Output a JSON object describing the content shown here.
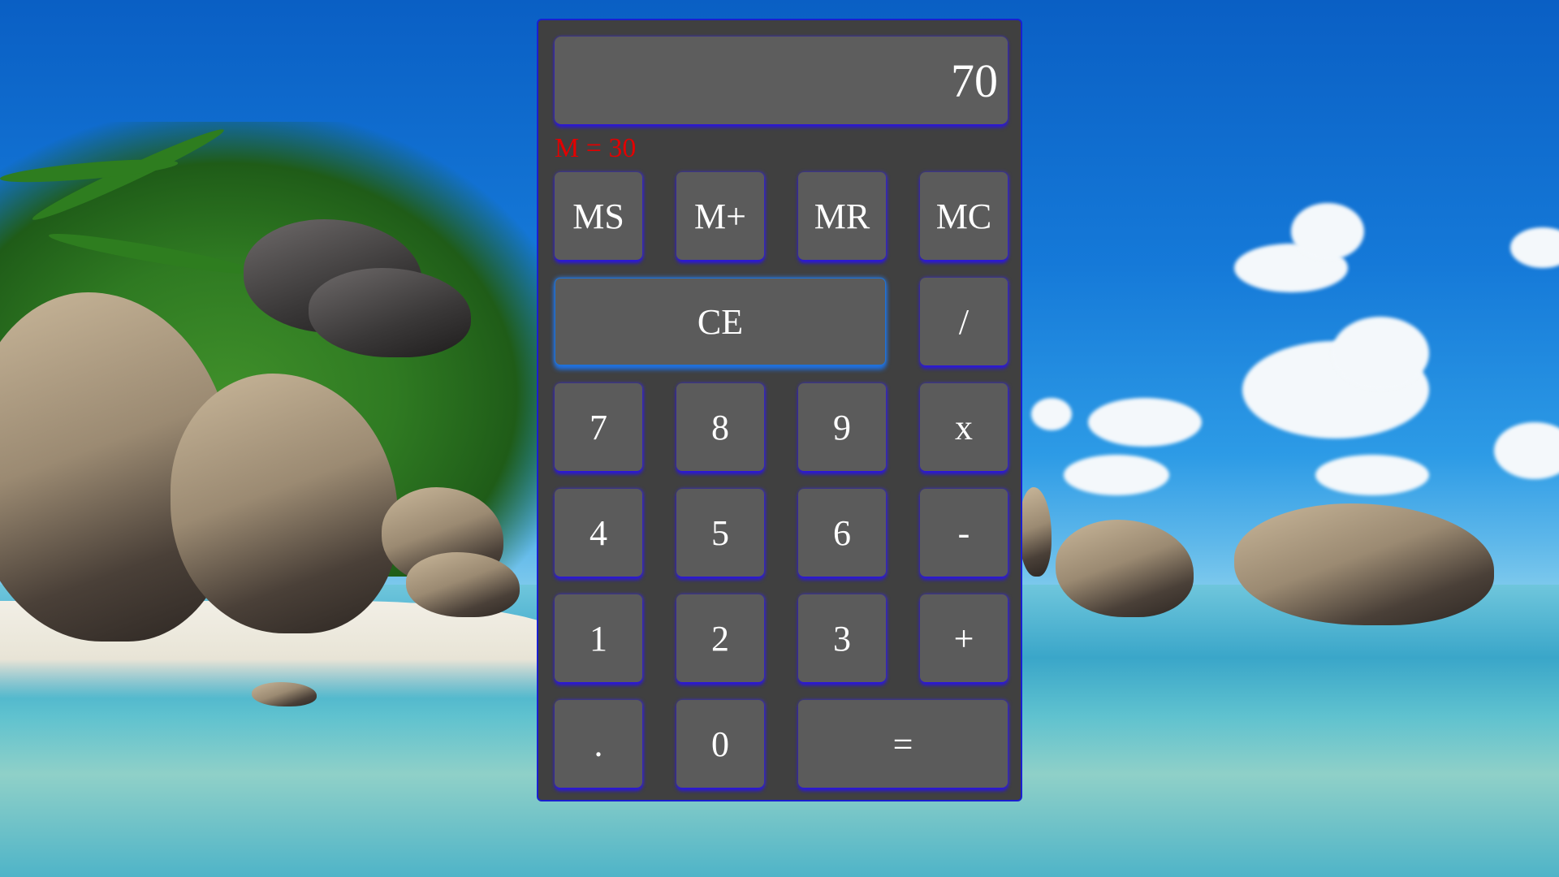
{
  "display": {
    "value": "70"
  },
  "memory": {
    "indicator": "M = 30"
  },
  "buttons": {
    "ms": "MS",
    "m_plus": "M+",
    "mr": "MR",
    "mc": "MC",
    "ce": "CE",
    "divide": "/",
    "multiply": "x",
    "subtract": "-",
    "add": "+",
    "equals": "=",
    "decimal": ".",
    "d0": "0",
    "d1": "1",
    "d2": "2",
    "d3": "3",
    "d4": "4",
    "d5": "5",
    "d6": "6",
    "d7": "7",
    "d8": "8",
    "d9": "9"
  },
  "colors": {
    "calculator_body": "#404040",
    "button_face": "#5b5b5b",
    "button_glow": "#2b17d8",
    "memory_text": "#e30000",
    "focus_glow": "#1f6fe0"
  }
}
